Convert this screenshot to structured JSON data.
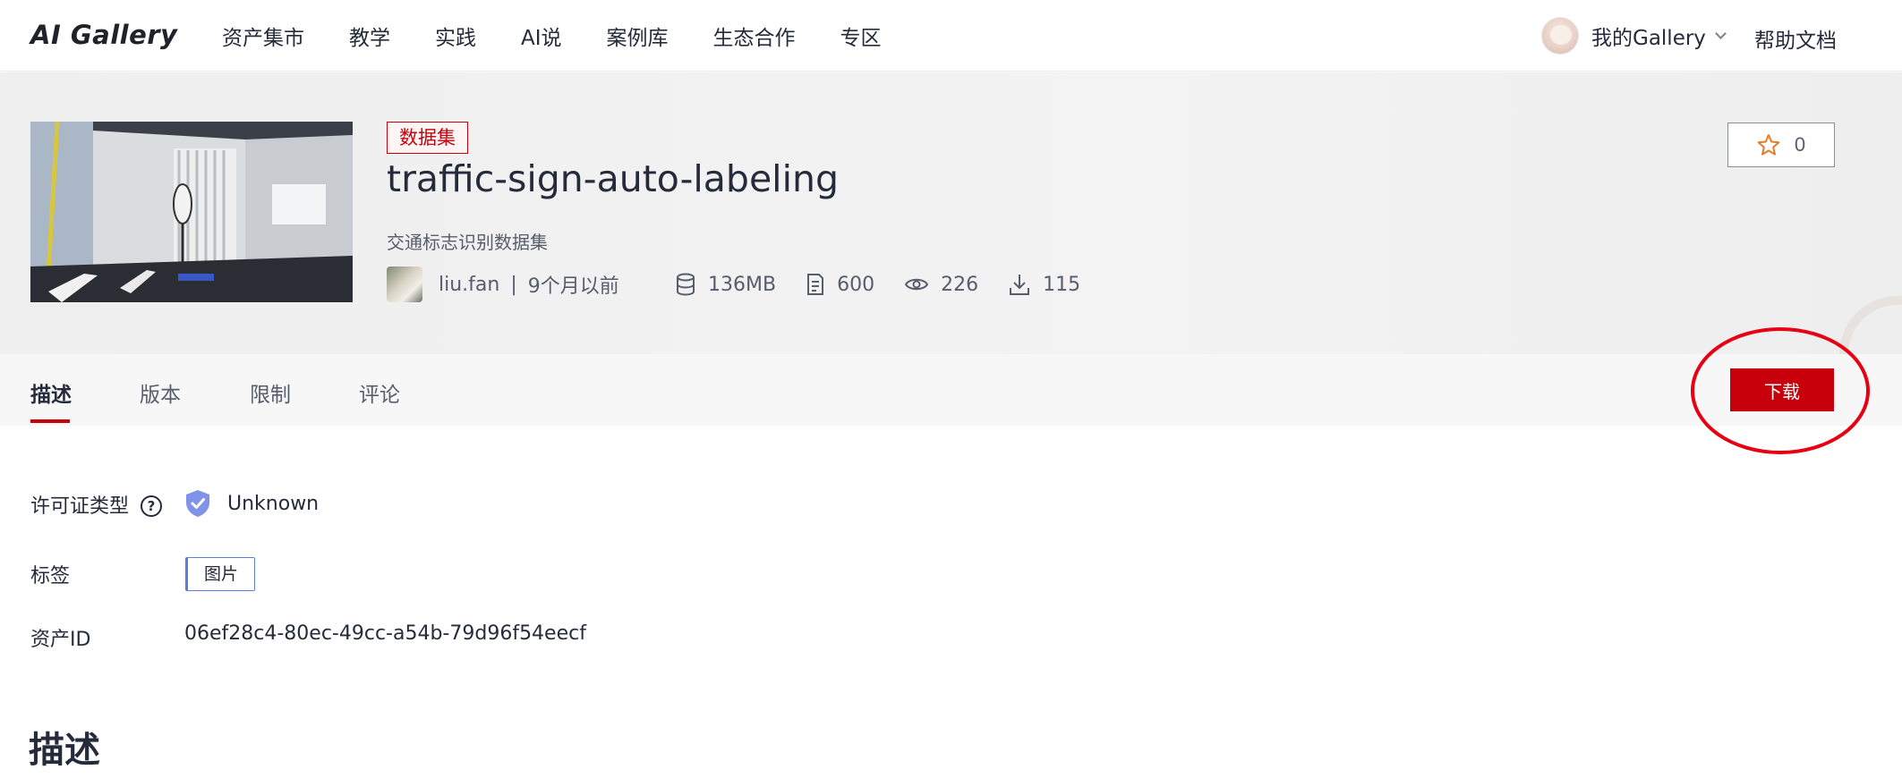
{
  "topbar": {
    "logo": "AI Gallery",
    "nav": [
      "资产集市",
      "教学",
      "实践",
      "AI说",
      "案例库",
      "生态合作",
      "专区"
    ],
    "user_label": "我的Gallery",
    "help_label": "帮助文档"
  },
  "asset": {
    "type_tag": "数据集",
    "title": "traffic-sign-auto-labeling",
    "subtitle": "交通标志识别数据集",
    "author": "liu.fan",
    "separator": "|",
    "updated": "9个月以前",
    "size": "136MB",
    "files": "600",
    "views": "226",
    "downloads": "115",
    "stars": "0"
  },
  "tabs": [
    "描述",
    "版本",
    "限制",
    "评论"
  ],
  "download_label": "下载",
  "info": {
    "license_label": "许可证类型",
    "license_help": "?",
    "license_value": "Unknown",
    "tags_label": "标签",
    "tags": [
      "图片"
    ],
    "asset_id_label": "资产ID",
    "asset_id": "06ef28c4-80ec-49cc-a54b-79d96f54eecf"
  },
  "section_title": "描述",
  "colors": {
    "accent": "#c7000b",
    "tag_border": "#5e7ce0",
    "highlight": "#e60012"
  }
}
